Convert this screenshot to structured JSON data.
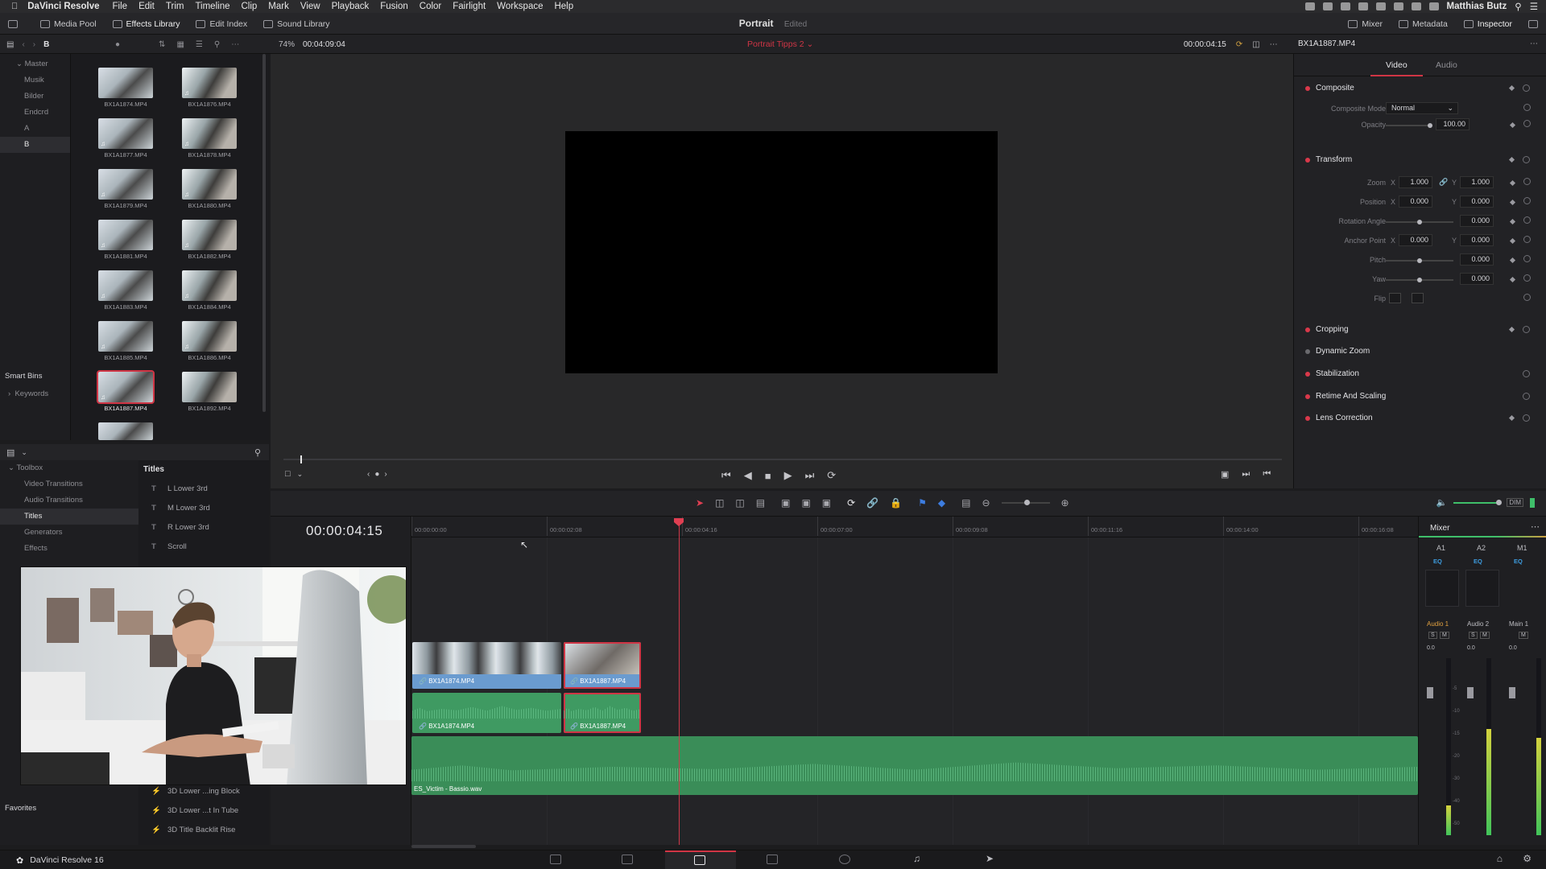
{
  "menubar": {
    "app": "DaVinci Resolve",
    "items": [
      "File",
      "Edit",
      "Trim",
      "Timeline",
      "Clip",
      "Mark",
      "View",
      "Playback",
      "Fusion",
      "Color",
      "Fairlight",
      "Workspace",
      "Help"
    ],
    "user": "Matthias Butz"
  },
  "toolbar": {
    "media_pool": "Media Pool",
    "effects_library": "Effects Library",
    "edit_index": "Edit Index",
    "sound_library": "Sound Library",
    "project": "Portrait",
    "project_status": "Edited",
    "mixer": "Mixer",
    "metadata": "Metadata",
    "inspector": "Inspector"
  },
  "row2": {
    "bin": "B",
    "zoom": "74%",
    "source_tc": "00:04:09:04",
    "timeline_name": "Portrait Tipps 2",
    "record_tc": "00:00:04:15",
    "clip_name": "BX1A1887.MP4"
  },
  "bins": {
    "master": "Master",
    "items": [
      "Musik",
      "Bilder",
      "Endcrd",
      "A",
      "B"
    ],
    "smart_bins": "Smart Bins",
    "keywords": "Keywords"
  },
  "clips": [
    "BX1A1874.MP4",
    "BX1A1876.MP4",
    "BX1A1877.MP4",
    "BX1A1878.MP4",
    "BX1A1879.MP4",
    "BX1A1880.MP4",
    "BX1A1881.MP4",
    "BX1A1882.MP4",
    "BX1A1883.MP4",
    "BX1A1884.MP4",
    "BX1A1885.MP4",
    "BX1A1886.MP4",
    "BX1A1887.MP4",
    "BX1A1892.MP4"
  ],
  "inspector": {
    "tabs": [
      "Video",
      "Audio"
    ],
    "composite": "Composite",
    "composite_mode_label": "Composite Mode",
    "composite_mode": "Normal",
    "opacity_label": "Opacity",
    "opacity": "100.00",
    "transform": "Transform",
    "zoom_label": "Zoom",
    "zoom_x": "1.000",
    "zoom_y": "1.000",
    "position_label": "Position",
    "position_x": "0.000",
    "position_y": "0.000",
    "rotation_label": "Rotation Angle",
    "rotation": "0.000",
    "anchor_label": "Anchor Point",
    "anchor_x": "0.000",
    "anchor_y": "0.000",
    "pitch_label": "Pitch",
    "pitch": "0.000",
    "yaw_label": "Yaw",
    "yaw": "0.000",
    "flip_label": "Flip",
    "x": "X",
    "y": "Y",
    "cropping": "Cropping",
    "dynamic_zoom": "Dynamic Zoom",
    "stabilization": "Stabilization",
    "retime": "Retime And Scaling",
    "lens": "Lens Correction"
  },
  "effects": {
    "toolbox": "Toolbox",
    "categories": [
      "Video Transitions",
      "Audio Transitions",
      "Titles",
      "Generators",
      "Effects"
    ],
    "titles_header": "Titles",
    "titles": [
      "L Lower 3rd",
      "M Lower 3rd",
      "R Lower 3rd",
      "Scroll"
    ],
    "fusion_titles": [
      "3D Lower ...ing Block",
      "3D Lower ...t In Tube",
      "3D Title Backlit Rise"
    ],
    "favorites": "Favorites"
  },
  "timeline": {
    "timecode": "00:00:04:15",
    "ruler": [
      "00:00:00:00",
      "00:00:02:08",
      "00:00:04:16",
      "00:00:07:00",
      "00:00:09:08",
      "00:00:11:16",
      "00:00:14:00",
      "00:00:16:08"
    ],
    "v1_clip1": "BX1A1874.MP4",
    "v1_clip2": "BX1A1887.MP4",
    "a1_clip1": "BX1A1874.MP4",
    "a1_clip2": "BX1A1887.MP4",
    "music": "ES_Victim - Bassio.wav"
  },
  "mixer": {
    "title": "Mixer",
    "channels": [
      "A1",
      "A2",
      "M1"
    ],
    "eq": "EQ",
    "names": [
      "Audio 1",
      "Audio 2",
      "Main 1"
    ],
    "levels": [
      "0.0",
      "0.0",
      "0.0"
    ],
    "scale": [
      "-5",
      "-10",
      "-15",
      "-20",
      "-30",
      "-40",
      "-50"
    ],
    "meter_levels": [
      0.17,
      0.6,
      0.55
    ]
  },
  "pagebar": {
    "app_version": "DaVinci Resolve 16"
  },
  "colors": {
    "accent_red": "#d03545",
    "video_clip": "#6a9bcf",
    "audio_clip": "#3f9a62"
  }
}
